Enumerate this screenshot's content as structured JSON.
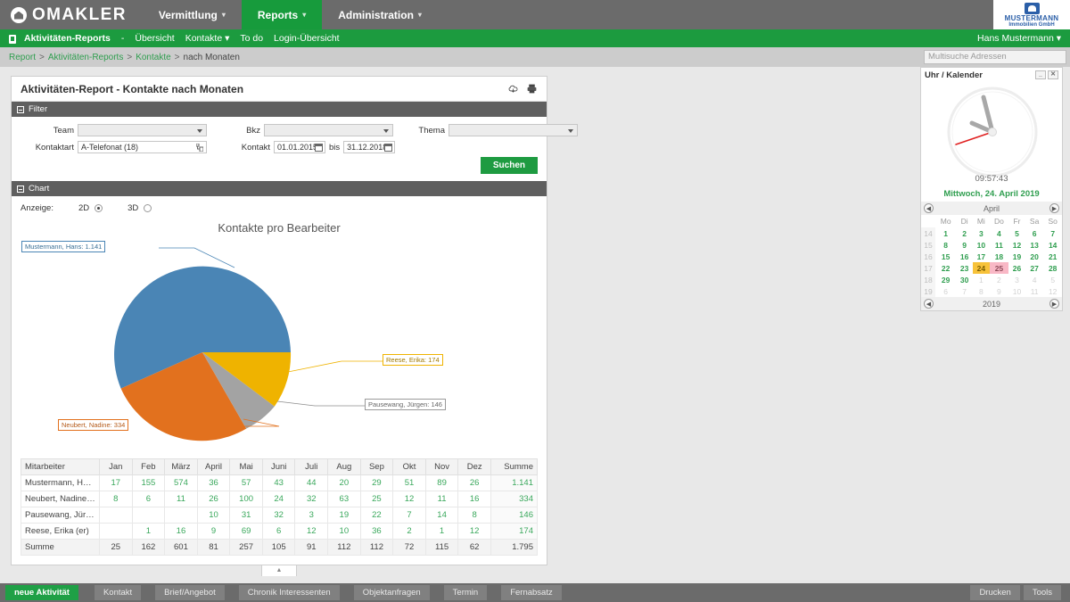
{
  "topbar": {
    "brand": "OMAKLER",
    "brand_logo_icon": "house-circle-logo",
    "nav": [
      {
        "label": "Vermittlung",
        "active": false,
        "caret": "▾"
      },
      {
        "label": "Reports",
        "active": true,
        "caret": "▾"
      },
      {
        "label": "Administration",
        "active": false,
        "caret": "▾"
      }
    ],
    "corp": {
      "line1": "MUSTERMANN",
      "line2": "Immobilien GmbH",
      "icon": "company-mark-icon"
    }
  },
  "subbar": {
    "doc_icon": "report-doc-icon",
    "items": [
      {
        "label": "Aktivitäten-Reports",
        "bold": true
      },
      {
        "label": "-",
        "bold": false
      },
      {
        "label": "Übersicht",
        "bold": false
      },
      {
        "label": "Kontakte ▾",
        "bold": false
      },
      {
        "label": "To do",
        "bold": false
      },
      {
        "label": "Login-Übersicht",
        "bold": false
      }
    ],
    "user": "Hans Mustermann ▾"
  },
  "breadcrumb": {
    "items": [
      "Report",
      "Aktivitäten-Reports",
      "Kontakte"
    ],
    "current": "nach Monaten",
    "separator": ">"
  },
  "search": {
    "placeholder": "Multisuche Adressen",
    "value": ""
  },
  "panel": {
    "title": "Aktivitäten-Report - Kontakte nach Monaten",
    "download_icon": "cloud-download-icon",
    "print_icon": "printer-icon"
  },
  "filter": {
    "section_title": "Filter",
    "team_label": "Team",
    "team_value": "",
    "bkz_label": "Bkz",
    "bkz_value": "",
    "thema_label": "Thema",
    "thema_value": "",
    "kontaktart_label": "Kontaktart",
    "kontaktart_value": "A-Telefonat (18)",
    "kontaktart_picker_icon": "list-picker-icon",
    "kontakt_label": "Kontakt",
    "date_from": "01.01.2015",
    "date_bis_label": "bis",
    "date_to": "31.12.2018",
    "calendar_icon": "calendar-icon",
    "search_button": "Suchen"
  },
  "chart_panel": {
    "section_title": "Chart",
    "anzeige_label": "Anzeige:",
    "mode_2d": "2D",
    "mode_3d": "3D",
    "selected_mode": "2D"
  },
  "chart_data": {
    "type": "pie",
    "title": "Kontakte pro Bearbeiter",
    "xlabel": "",
    "ylabel": "",
    "legend_position": "callout-labels",
    "categories": [
      "Mustermann, Hans",
      "Neubert, Nadine",
      "Pausewang, Jürgen",
      "Reese, Erika"
    ],
    "values": [
      1141,
      334,
      146,
      174
    ],
    "value_labels": [
      "1.141",
      "334",
      "146",
      "174"
    ],
    "total": 1795,
    "colors": [
      "#4a85b5",
      "#e2711e",
      "#a3a3a3",
      "#efb300"
    ],
    "callouts": [
      {
        "text": "Mustermann, Hans: 1.141",
        "color": "#4a85b5"
      },
      {
        "text": "Neubert, Nadine: 334",
        "color": "#e2711e"
      },
      {
        "text": "Pausewang, Jürgen: 146",
        "color": "#a3a3a3"
      },
      {
        "text": "Reese, Erika: 174",
        "color": "#efb300"
      }
    ]
  },
  "table": {
    "columns": [
      "Mitarbeiter",
      "Jan",
      "Feb",
      "März",
      "April",
      "Mai",
      "Juni",
      "Juli",
      "Aug",
      "Sep",
      "Okt",
      "Nov",
      "Dez",
      "Summe"
    ],
    "rows": [
      {
        "name": "Mustermann, Hans (...",
        "values": [
          "17",
          "155",
          "574",
          "36",
          "57",
          "43",
          "44",
          "20",
          "29",
          "51",
          "89",
          "26"
        ],
        "sum": "1.141"
      },
      {
        "name": "Neubert, Nadine (nn)",
        "values": [
          "8",
          "6",
          "11",
          "26",
          "100",
          "24",
          "32",
          "63",
          "25",
          "12",
          "11",
          "16"
        ],
        "sum": "334"
      },
      {
        "name": "Pausewang, Jürgen ...",
        "values": [
          "",
          "",
          "",
          "10",
          "31",
          "32",
          "3",
          "19",
          "22",
          "7",
          "14",
          "8"
        ],
        "sum": "146"
      },
      {
        "name": "Reese, Erika (er)",
        "values": [
          "",
          "1",
          "16",
          "9",
          "69",
          "6",
          "12",
          "10",
          "36",
          "2",
          "1",
          "12"
        ],
        "sum": "174"
      }
    ],
    "total_row": {
      "name": "Summe",
      "values": [
        "25",
        "162",
        "601",
        "81",
        "257",
        "105",
        "91",
        "112",
        "112",
        "72",
        "115",
        "62"
      ],
      "sum": "1.795"
    },
    "collapse_handle": "▲"
  },
  "widget": {
    "title": "Uhr / Kalender",
    "minimize_icon": "minimize-icon",
    "close_icon": "close-icon",
    "minimize_label": "_",
    "close_label": "✕",
    "clock_time": "09:57:43",
    "date_line": "Mittwoch, 24. April 2019",
    "month_label": "April",
    "year_label": "2019",
    "prev_icon": "arrow-left-circle-icon",
    "next_icon": "arrow-right-circle-icon",
    "prev_glyph": "◀",
    "next_glyph": "▶",
    "weekday_headers": [
      "Mo",
      "Di",
      "Mi",
      "Do",
      "Fr",
      "Sa",
      "So"
    ],
    "weeks": [
      {
        "wk": "14",
        "days": [
          {
            "d": "1",
            "t": "in"
          },
          {
            "d": "2",
            "t": "in"
          },
          {
            "d": "3",
            "t": "in"
          },
          {
            "d": "4",
            "t": "in"
          },
          {
            "d": "5",
            "t": "in"
          },
          {
            "d": "6",
            "t": "in"
          },
          {
            "d": "7",
            "t": "in"
          }
        ]
      },
      {
        "wk": "15",
        "days": [
          {
            "d": "8",
            "t": "in"
          },
          {
            "d": "9",
            "t": "in"
          },
          {
            "d": "10",
            "t": "in"
          },
          {
            "d": "11",
            "t": "in"
          },
          {
            "d": "12",
            "t": "in"
          },
          {
            "d": "13",
            "t": "in"
          },
          {
            "d": "14",
            "t": "in"
          }
        ]
      },
      {
        "wk": "16",
        "days": [
          {
            "d": "15",
            "t": "in"
          },
          {
            "d": "16",
            "t": "in"
          },
          {
            "d": "17",
            "t": "in"
          },
          {
            "d": "18",
            "t": "in"
          },
          {
            "d": "19",
            "t": "in"
          },
          {
            "d": "20",
            "t": "in"
          },
          {
            "d": "21",
            "t": "in"
          }
        ]
      },
      {
        "wk": "17",
        "days": [
          {
            "d": "22",
            "t": "in"
          },
          {
            "d": "23",
            "t": "in"
          },
          {
            "d": "24",
            "t": "today"
          },
          {
            "d": "25",
            "t": "sel"
          },
          {
            "d": "26",
            "t": "in"
          },
          {
            "d": "27",
            "t": "in"
          },
          {
            "d": "28",
            "t": "in"
          }
        ]
      },
      {
        "wk": "18",
        "days": [
          {
            "d": "29",
            "t": "in"
          },
          {
            "d": "30",
            "t": "in"
          },
          {
            "d": "1",
            "t": "out"
          },
          {
            "d": "2",
            "t": "out"
          },
          {
            "d": "3",
            "t": "out"
          },
          {
            "d": "4",
            "t": "out"
          },
          {
            "d": "5",
            "t": "out"
          }
        ]
      },
      {
        "wk": "19",
        "days": [
          {
            "d": "6",
            "t": "out"
          },
          {
            "d": "7",
            "t": "out"
          },
          {
            "d": "8",
            "t": "out"
          },
          {
            "d": "9",
            "t": "out"
          },
          {
            "d": "10",
            "t": "out"
          },
          {
            "d": "11",
            "t": "out"
          },
          {
            "d": "12",
            "t": "out"
          }
        ]
      }
    ]
  },
  "footer": {
    "left_buttons": [
      {
        "label": "neue Aktivität",
        "primary": true
      },
      {
        "label": "Kontakt",
        "primary": false
      },
      {
        "label": "Brief/Angebot",
        "primary": false
      },
      {
        "label": "Chronik Interessenten",
        "primary": false
      },
      {
        "label": "Objektanfragen",
        "primary": false
      },
      {
        "label": "Termin",
        "primary": false
      },
      {
        "label": "Fernabsatz",
        "primary": false
      }
    ],
    "right_buttons": [
      {
        "label": "Drucken"
      },
      {
        "label": "Tools"
      }
    ]
  },
  "colors": {
    "green": "#1c9b3f",
    "gray_bar": "#6b6b6b",
    "accent_blue": "#4a85b5"
  }
}
